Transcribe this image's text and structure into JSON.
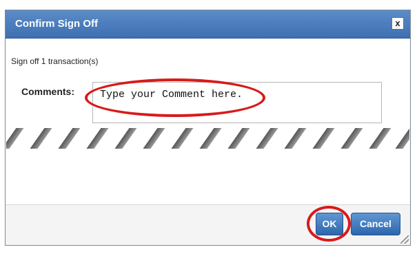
{
  "dialog": {
    "title": "Confirm Sign Off",
    "close_glyph": "x",
    "sign_off_text": "Sign off 1 transaction(s)",
    "comments_label": "Comments:",
    "comment_value": "Type your Comment here."
  },
  "buttons": {
    "ok_label": "OK",
    "cancel_label": "Cancel"
  },
  "colors": {
    "titlebar": "#4b7dbf",
    "highlight_ring": "#d81a1a",
    "button": "#2e66ad"
  }
}
